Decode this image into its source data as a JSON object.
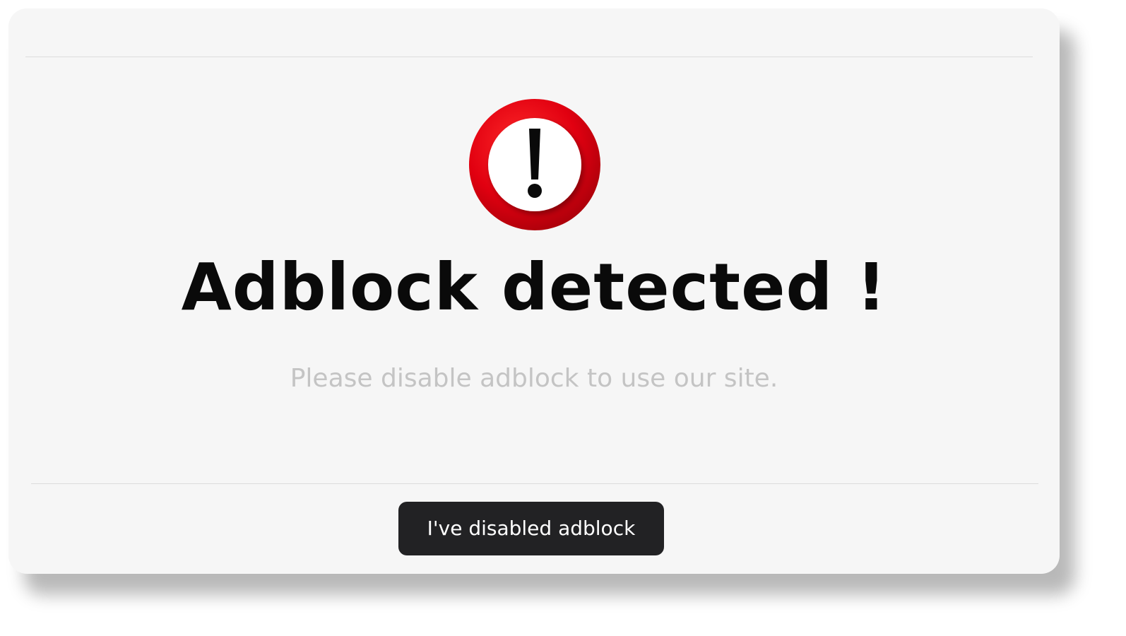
{
  "modal": {
    "headline": "Adblock detected !",
    "message": "Please disable adblock to use our site.",
    "confirm_button_label": "I've disabled adblock",
    "icon": "exclamation-alert-icon",
    "colors": {
      "alert_ring": "#e10010",
      "button_bg": "#222224",
      "headline": "#0a0a0a",
      "message": "#c4c4c4",
      "background": "#f6f6f6"
    }
  }
}
